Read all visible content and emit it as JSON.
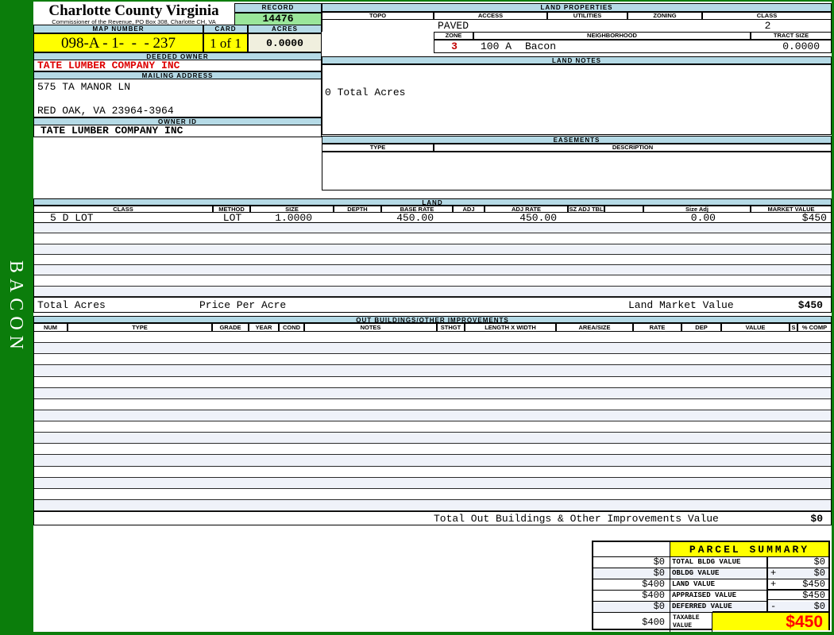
{
  "page": {
    "sidebar_label": "BACON"
  },
  "header": {
    "county_title": "Charlotte County Virginia",
    "county_subtitle": "Commissioner of the Revenue, PO Box 308, Charlotte CH, VA",
    "record_label": "RECORD",
    "record_value": "14476",
    "map_number_label": "MAP NUMBER",
    "map_number_value": "098-A - 1-  -  - 237",
    "card_label": "CARD",
    "card_value": "1 of 1",
    "acres_label": "ACRES",
    "acres_value": "0.0000"
  },
  "owner": {
    "deeded_owner_label": "DEEDED OWNER",
    "deeded_owner": "TATE LUMBER COMPANY INC",
    "mailing_address_label": "MAILING ADDRESS",
    "address_line1": "575 TA MANOR LN",
    "address_line2": "RED OAK, VA 23964-3964",
    "owner_id_label": "OWNER ID",
    "owner_id": "TATE LUMBER COMPANY INC"
  },
  "land_properties": {
    "title": "LAND PROPERTIES",
    "columns": [
      "TOPO",
      "ACCESS",
      "UTILITIES",
      "ZONING",
      "CLASS"
    ],
    "access_value": "PAVED",
    "class_value": "2",
    "zone_label": "ZONE",
    "zone_value": "3",
    "neighborhood_label": "NEIGHBORHOOD",
    "neighborhood_code": "100 A",
    "neighborhood_name": "Bacon",
    "tract_size_label": "TRACT SIZE",
    "tract_size_value": "0.0000"
  },
  "land_notes": {
    "title": "LAND NOTES",
    "note": "0 Total Acres"
  },
  "easements": {
    "title": "EASEMENTS",
    "columns": [
      "TYPE",
      "DESCRIPTION"
    ]
  },
  "land": {
    "title": "LAND",
    "columns": [
      "CLASS",
      "METHOD",
      "SIZE",
      "DEPTH",
      "BASE RATE",
      "ADJ",
      "ADJ RATE",
      "SZ ADJ TBL",
      "",
      "Size Adj",
      "MARKET VALUE"
    ],
    "row": {
      "class": "5 D LOT",
      "method": "LOT",
      "size": "1.0000",
      "base_rate": "450.00",
      "adj_rate": "450.00",
      "size_adj": "0.00",
      "market_value": "$450"
    },
    "totals": {
      "total_acres_label": "Total Acres",
      "price_per_acre_label": "Price Per Acre",
      "land_market_value_label": "Land Market Value",
      "land_market_value": "$450"
    }
  },
  "out_buildings": {
    "title": "OUT BUILDINGS/OTHER IMPROVEMENTS",
    "columns": [
      "NUM",
      "TYPE",
      "GRADE",
      "YEAR",
      "COND",
      "NOTES",
      "STHGT",
      "LENGTH X WIDTH",
      "AREA/SIZE",
      "RATE",
      "DEP",
      "VALUE",
      "S",
      "% COMP"
    ],
    "total_label": "Total Out Buildings & Other Improvements Value",
    "total_value": "$0"
  },
  "parcel_summary": {
    "title": "PARCEL SUMMARY",
    "rows": [
      {
        "prior": "$0",
        "label": "TOTAL BLDG VALUE",
        "op": "",
        "value": "$0"
      },
      {
        "prior": "$0",
        "label": "OBLDG VALUE",
        "op": "+",
        "value": "$0"
      },
      {
        "prior": "$400",
        "label": "LAND VALUE",
        "op": "+",
        "value": "$450"
      },
      {
        "prior": "$400",
        "label": "APPRAISED VALUE",
        "op": "",
        "value": "$450"
      },
      {
        "prior": "$0",
        "label": "DEFERRED VALUE",
        "op": "-",
        "value": "$0"
      }
    ],
    "taxable": {
      "prior": "$400",
      "label_line1": "TAXABLE",
      "label_line2": "VALUE",
      "value": "$450"
    }
  },
  "colors": {
    "background_green": "#0b7d0b",
    "band_blue": "#b5dae6",
    "highlight_yellow": "#ffff00",
    "record_green": "#9ae69a",
    "acres_beige": "#f0efde",
    "owner_red": "#dd0000",
    "taxable_red": "#ff0000",
    "alt_row": "#eff2f9"
  }
}
